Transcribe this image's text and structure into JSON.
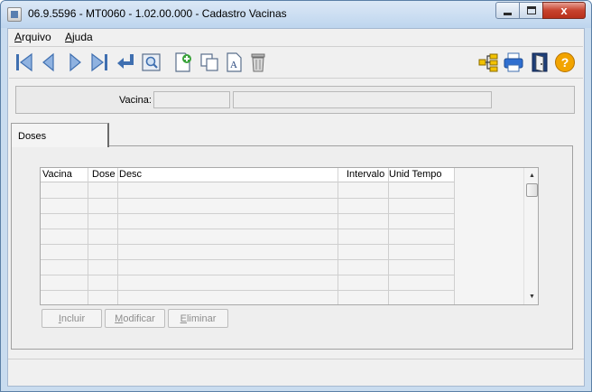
{
  "window": {
    "title": "06.9.5596 - MT0060 - 1.02.00.000 - Cadastro Vacinas",
    "close_glyph": "x"
  },
  "menu": {
    "arquivo": {
      "first": "A",
      "rest": "rquivo"
    },
    "ajuda": {
      "first": "A",
      "rest": "juda"
    }
  },
  "toolbar": {
    "icons": [
      "first-record-icon",
      "previous-record-icon",
      "next-record-icon",
      "last-record-icon",
      "goto-return-icon",
      "search-icon",
      "new-record-icon",
      "copy-record-icon",
      "edit-record-icon",
      "delete-record-icon",
      "structure-icon",
      "print-icon",
      "exit-door-icon",
      "help-icon"
    ],
    "colors": {
      "nav_blue": "#3f6fb0",
      "nav_light": "#8fb2e0",
      "add_green": "#3ba33b",
      "help_orange": "#f2a400"
    }
  },
  "header": {
    "vacina_label": "Vacina:",
    "vacina_code": "",
    "vacina_desc": ""
  },
  "tabs": [
    {
      "label": "Doses",
      "selected": true
    }
  ],
  "grid": {
    "columns": [
      "Vacina",
      "Dose",
      "Desc",
      "Intervalo",
      "Unid Tempo"
    ],
    "rows": []
  },
  "buttons": {
    "incluir": {
      "first": "I",
      "rest": "ncluir",
      "enabled": false
    },
    "modificar": {
      "first": "M",
      "rest": "odificar",
      "enabled": false
    },
    "eliminar": {
      "first": "E",
      "rest": "liminar",
      "enabled": false
    }
  }
}
